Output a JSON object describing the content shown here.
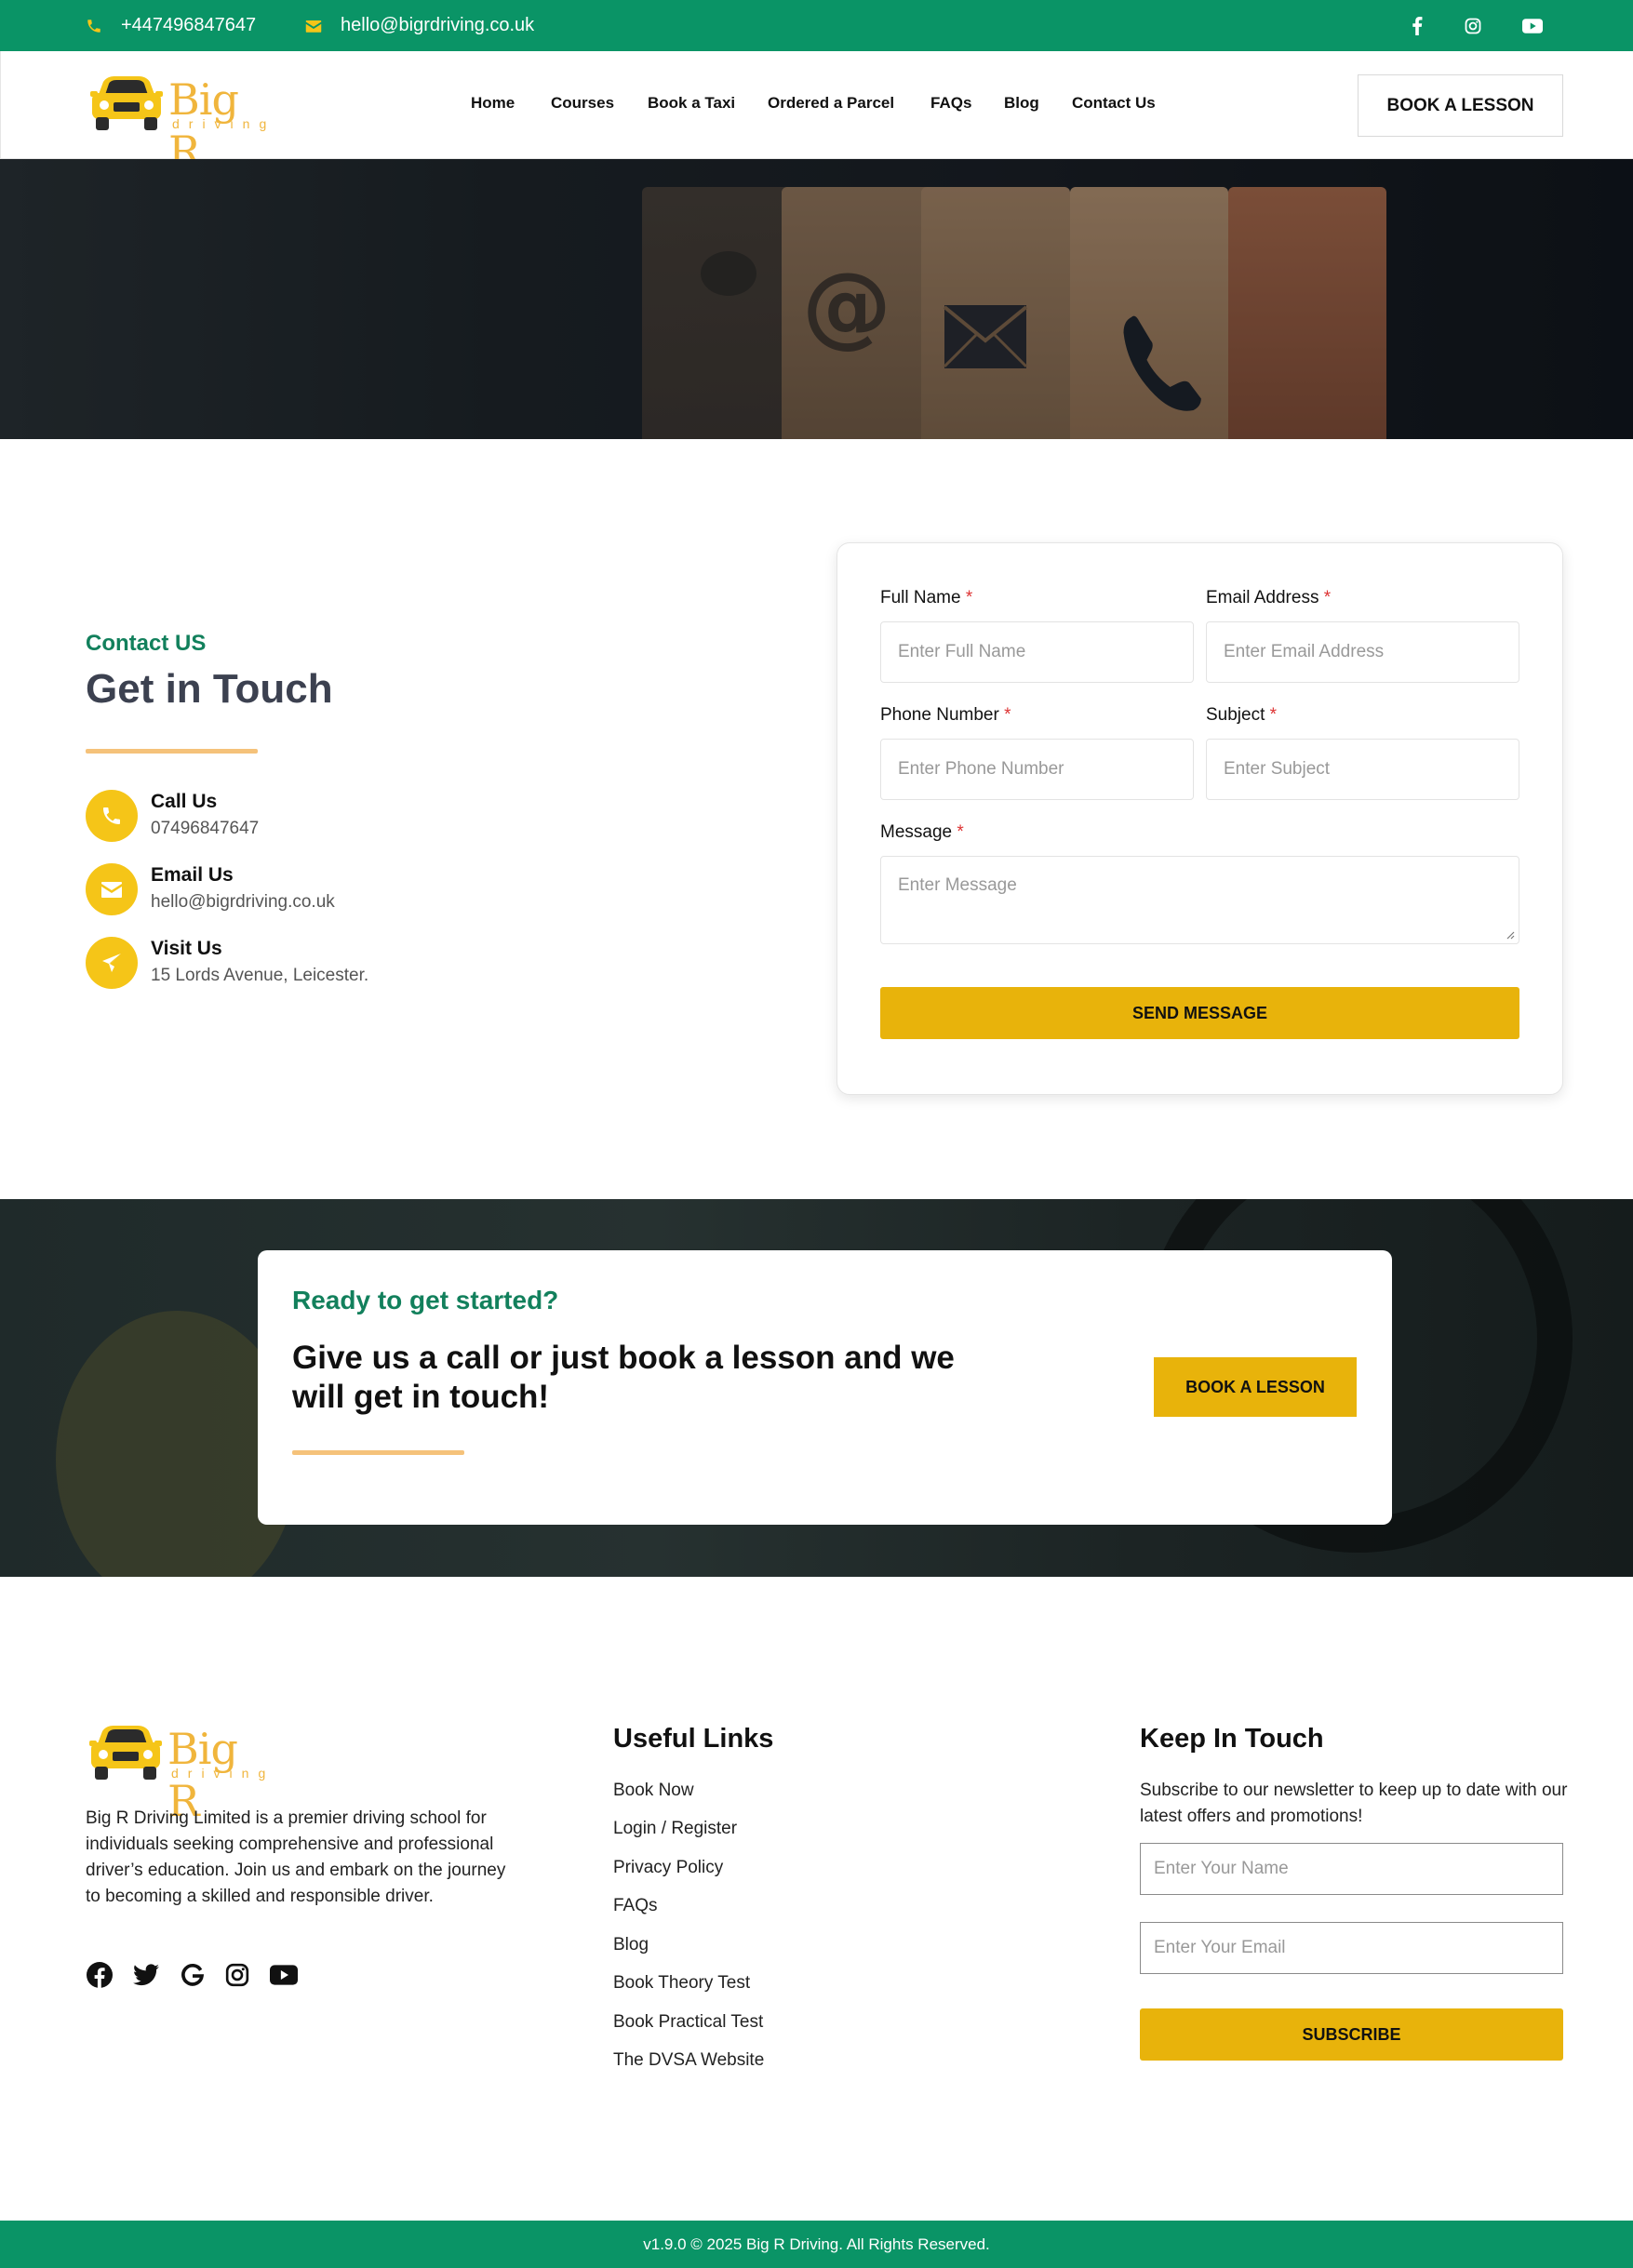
{
  "topbar": {
    "phone": "+447496847647",
    "email": "hello@bigrdriving.co.uk",
    "icons": [
      "phone-icon",
      "envelope-icon",
      "facebook-icon",
      "instagram-icon",
      "youtube-icon"
    ]
  },
  "brand": {
    "logo_big": "Big R",
    "logo_small": "driving"
  },
  "nav": {
    "items": [
      "Home",
      "Courses",
      "Book a Taxi",
      "Ordered a Parcel",
      "FAQs",
      "Blog",
      "Contact Us"
    ]
  },
  "header": {
    "cta_label": "BOOK A LESSON"
  },
  "contact": {
    "eyebrow": "Contact US",
    "title": "Get in Touch",
    "items": [
      {
        "label": "Call Us",
        "value": "07496847647",
        "icon": "phone-icon"
      },
      {
        "label": "Email Us",
        "value": "hello@bigrdriving.co.uk",
        "icon": "envelope-icon"
      },
      {
        "label": "Visit Us",
        "value": "15 Lords Avenue, Leicester.",
        "icon": "paper-plane-icon"
      }
    ]
  },
  "form": {
    "fields": [
      {
        "label": "Full Name",
        "required_mark": "*",
        "placeholder": "Enter Full Name"
      },
      {
        "label": "Email Address",
        "required_mark": "*",
        "placeholder": "Enter Email Address"
      },
      {
        "label": "Phone Number",
        "required_mark": "*",
        "placeholder": "Enter Phone Number"
      },
      {
        "label": "Subject",
        "required_mark": "*",
        "placeholder": "Enter Subject"
      },
      {
        "label": "Message",
        "required_mark": "*",
        "placeholder": "Enter Message"
      }
    ],
    "submit_label": "SEND MESSAGE"
  },
  "cta": {
    "eyebrow": "Ready to get started?",
    "heading": "Give us a call or just book a lesson and we will get in touch!",
    "button_label": "BOOK A LESSON"
  },
  "footer": {
    "about": "Big R Driving Limited is a premier driving school for individuals seeking comprehensive and professional driver’s education. Join us and embark on the journey to becoming a skilled and responsible driver.",
    "social_icons": [
      "facebook-icon",
      "twitter-icon",
      "google-icon",
      "instagram-icon",
      "youtube-icon"
    ],
    "links_heading": "Useful Links",
    "links": [
      "Book Now",
      "Login / Register",
      "Privacy Policy",
      "FAQs",
      "Blog",
      "Book Theory Test",
      "Book Practical Test",
      "The DVSA Website"
    ],
    "newsletter_heading": "Keep In Touch",
    "newsletter_text": "Subscribe to our newsletter to keep up to date with our latest offers and promotions!",
    "name_placeholder": "Enter Your Name",
    "email_placeholder": "Enter Your Email",
    "subscribe_label": "SUBSCRIBE",
    "copyright": "v1.9.0 © 2025 Big R Driving. All Rights Reserved."
  },
  "colors": {
    "brand_green": "#0a9466",
    "accent_yellow": "#e8b30b",
    "icon_yellow": "#f5c518",
    "heading_slate": "#3c4150",
    "eyebrow_green": "#12805c"
  }
}
